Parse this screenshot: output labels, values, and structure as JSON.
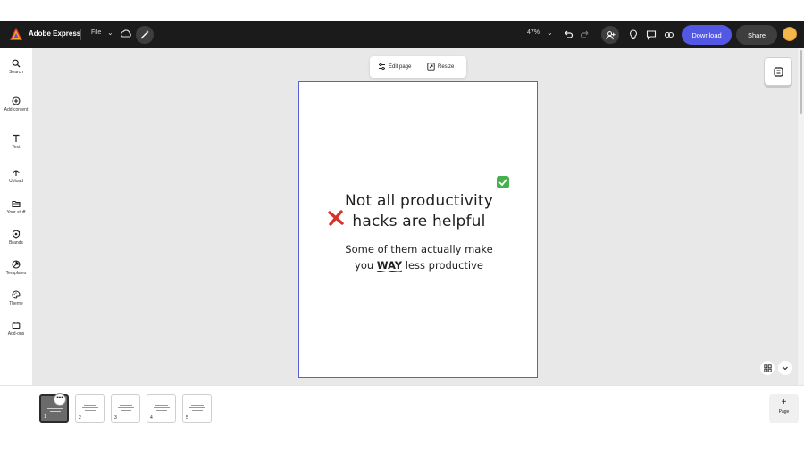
{
  "app": {
    "name": "Adobe Express",
    "file_menu": "File",
    "zoom_level": "47%",
    "download_label": "Download",
    "share_label": "Share",
    "accent_color": "#5258e4"
  },
  "sidebar": {
    "items": [
      {
        "label": "Search",
        "icon": "search-icon"
      },
      {
        "label": "Add content",
        "icon": "plus-circle-icon"
      },
      {
        "label": "Text",
        "icon": "text-icon"
      },
      {
        "label": "Upload",
        "icon": "upload-icon"
      },
      {
        "label": "Your stuff",
        "icon": "folder-icon"
      },
      {
        "label": "Brands",
        "icon": "brand-icon"
      },
      {
        "label": "Templates",
        "icon": "templates-icon"
      },
      {
        "label": "Theme",
        "icon": "palette-icon"
      },
      {
        "label": "Add-ons",
        "icon": "addons-icon"
      }
    ]
  },
  "page_tools": {
    "edit_page": "Edit page",
    "resize": "Resize"
  },
  "artboard": {
    "headline_line1": "Not all productivity",
    "headline_line2": "hacks are helpful",
    "sub_line1": "Some of them actually make",
    "sub_before": "you ",
    "sub_emphasis": "WAY",
    "sub_after": " less productive"
  },
  "pages": {
    "thumbnails": [
      {
        "number": "1",
        "active": true
      },
      {
        "number": "2",
        "active": false
      },
      {
        "number": "3",
        "active": false
      },
      {
        "number": "4",
        "active": false
      },
      {
        "number": "5",
        "active": false
      }
    ],
    "menu_glyph": "•••",
    "add_plus": "+",
    "add_label": "Page"
  }
}
